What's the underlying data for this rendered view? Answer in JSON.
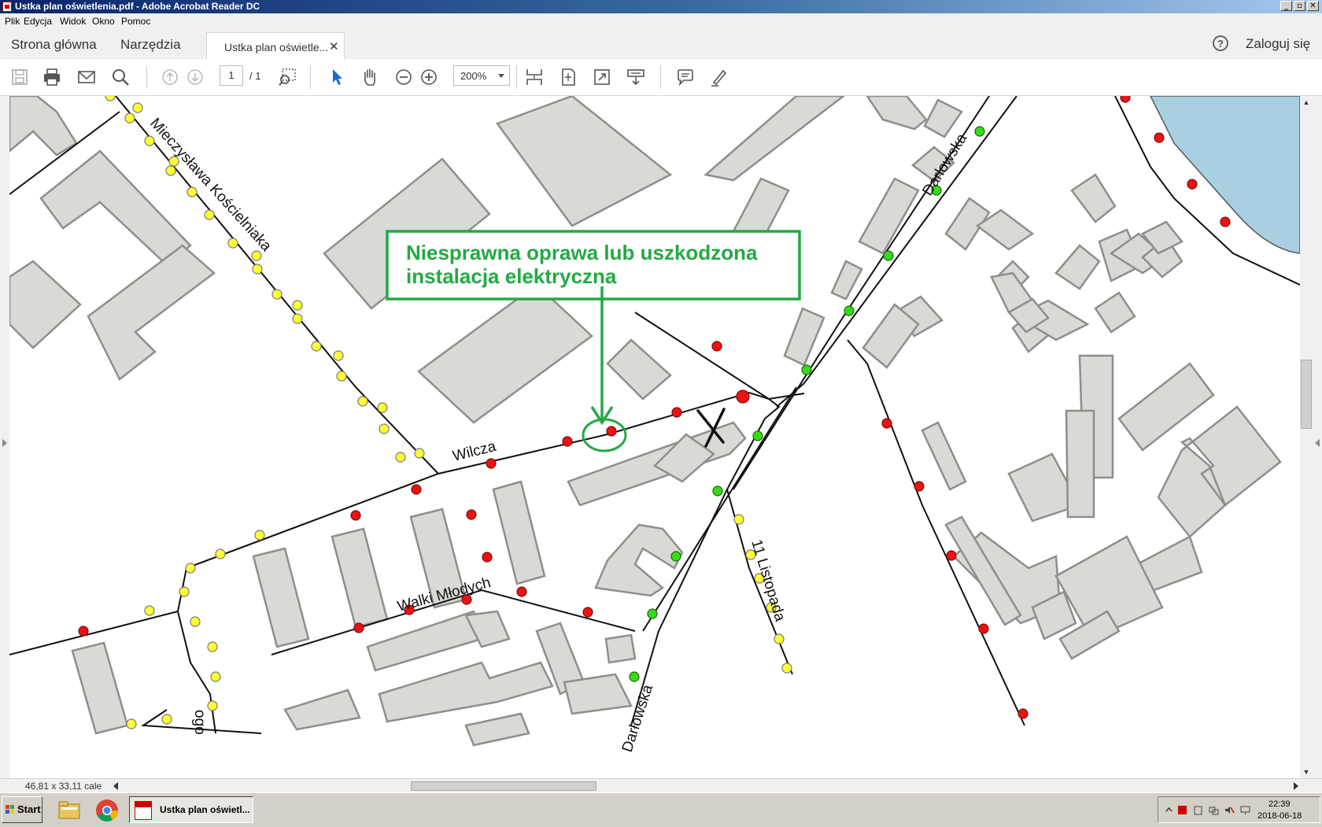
{
  "window": {
    "title": "Ustka plan oświetlenia.pdf - Adobe Acrobat Reader DC",
    "btn_min": "_",
    "btn_max": "▫",
    "btn_close": "✕"
  },
  "menu": [
    "Plik",
    "Edycja",
    "Widok",
    "Okno",
    "Pomoc"
  ],
  "tabs": {
    "home": "Strona główna",
    "tools": "Narzędzia",
    "document": "Ustka plan oświetle...",
    "close": "✕"
  },
  "account": {
    "help": "?",
    "login": "Zaloguj się"
  },
  "toolbar": {
    "page_current": "1",
    "page_total": "/ 1",
    "zoom": "200%"
  },
  "map": {
    "callout_line1": "Niesprawna oprawa lub uszkodzona",
    "callout_line2": "instalacja elektryczna",
    "streets": {
      "mieczyslawa": "Mieczysława Kościelniaka",
      "wilcza": "Wilcza",
      "walki": "Walki Młodych",
      "darlowska_top": "Darłowska",
      "darlowska_bottom": "Darłowska",
      "listopada": "11 Listopada",
      "partial": "ogo"
    },
    "colors": {
      "working_lamp": "#ffff33",
      "faulty_lamp": "#ee1111",
      "ok_lamp": "#33dd11",
      "building": "#d9d9d6",
      "water": "#a9d0e0",
      "callout": "#22aa44"
    }
  },
  "status": {
    "dimensions": "46,81 x 33,11 cale"
  },
  "taskbar": {
    "start": "Start",
    "task": "Ustka plan oświetl...",
    "time": "22:39",
    "date": "2018-06-18"
  }
}
